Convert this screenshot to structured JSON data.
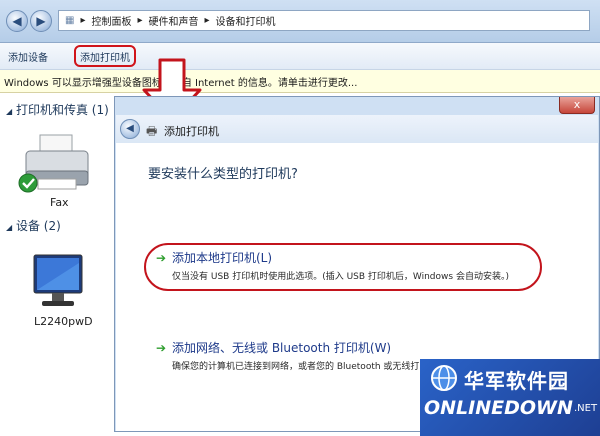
{
  "address_bar": {
    "path": [
      "控制面板",
      "硬件和声音",
      "设备和打印机"
    ],
    "separator": "▸"
  },
  "toolbar": {
    "add_device": "添加设备",
    "add_printer": "添加打印机"
  },
  "infobar": {
    "text": "Windows 可以显示增强型设备图标和来自 Internet 的信息。请单击进行更改..."
  },
  "left_pane": {
    "groups": [
      {
        "label": "打印机和传真 (1)"
      },
      {
        "label": "设备 (2)"
      }
    ],
    "items": [
      {
        "label": "Fax"
      },
      {
        "label": "L2240pwD"
      }
    ]
  },
  "dialog": {
    "title": "添加打印机",
    "close": "x",
    "question": "要安装什么类型的打印机?",
    "options": [
      {
        "title": "添加本地打印机(L)",
        "description": "仅当没有 USB 打印机时使用此选项。(插入 USB 打印机后，Windows 会自动安装。)"
      },
      {
        "title": "添加网络、无线或 Bluetooth 打印机(W)",
        "description": "确保您的计算机已连接到网络，或者您的 Bluetooth 或无线打印机已启用。"
      }
    ]
  },
  "watermark": {
    "cn": "华军软件园",
    "en": "ONLINEDOWN",
    "suffix": ".NET"
  },
  "colors": {
    "highlight": "#d0141a",
    "link": "#1e3a8a",
    "chrome": "#cfe0f3",
    "watermark_bg": "#2a63c8"
  }
}
